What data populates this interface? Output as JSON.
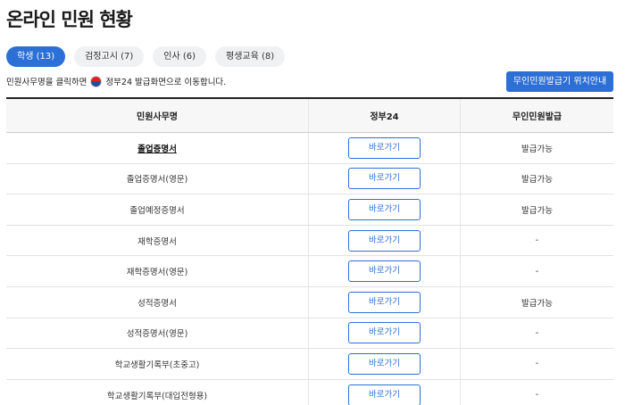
{
  "page_title": "온라인 민원 현황",
  "tabs": [
    {
      "label": "학생 (13)",
      "active": true
    },
    {
      "label": "검정고시 (7)",
      "active": false
    },
    {
      "label": "인사 (6)",
      "active": false
    },
    {
      "label": "평생교육 (8)",
      "active": false
    }
  ],
  "notice": {
    "prefix": "민원사무명을 클릭하면",
    "suffix": "정부24 발급화면으로 이동합니다.",
    "icon": "korea-flag-icon"
  },
  "kiosk_button_label": "무인민원발급기 위치안내",
  "table": {
    "headers": [
      "민원사무명",
      "정부24",
      "무인민원발급"
    ],
    "rows": [
      {
        "name": "졸업증명서",
        "button": "바로가기",
        "kiosk": "발급가능",
        "highlight": true
      },
      {
        "name": "졸업증명서(영문)",
        "button": "바로가기",
        "kiosk": "발급가능"
      },
      {
        "name": "졸업예정증명서",
        "button": "바로가기",
        "kiosk": "발급가능"
      },
      {
        "name": "재학증명서",
        "button": "바로가기",
        "kiosk": "-"
      },
      {
        "name": "재학증명서(영문)",
        "button": "바로가기",
        "kiosk": "-"
      },
      {
        "name": "성적증명서",
        "button": "바로가기",
        "kiosk": "발급가능"
      },
      {
        "name": "성적증명서(영문)",
        "button": "바로가기",
        "kiosk": "-"
      },
      {
        "name": "학교생활기록부(초중고)",
        "button": "바로가기",
        "kiosk": "-"
      },
      {
        "name": "학교생활기록부(대입전형용)",
        "button": "바로가기",
        "kiosk": "-"
      }
    ]
  },
  "colors": {
    "accent": "#2c6fd6",
    "tab_bg": "#f0f1f3"
  }
}
